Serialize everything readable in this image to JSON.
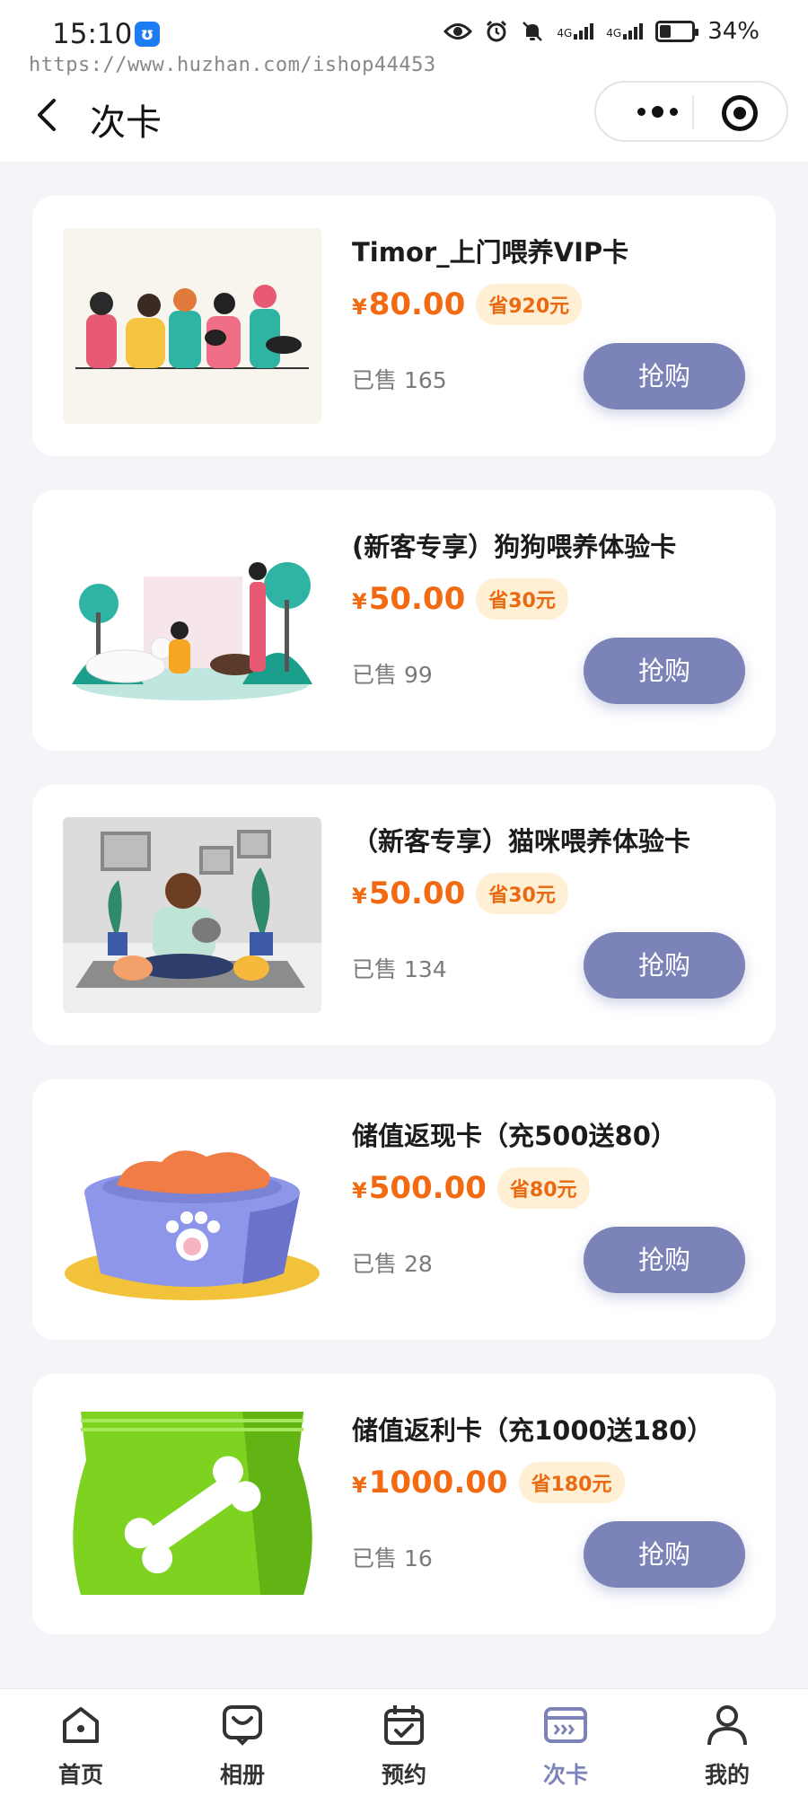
{
  "status_bar": {
    "time": "15:10",
    "battery": "34%",
    "battery_level": 0.34,
    "network_labels": [
      "4G",
      "4G"
    ]
  },
  "watermark": "https://www.huzhan.com/ishop44453",
  "header": {
    "title": "次卡"
  },
  "cards": [
    {
      "title": "Timor_上门喂养VIP卡",
      "currency": "¥",
      "price": "80.00",
      "save": "省920元",
      "sold": "已售 165",
      "button": "抢购",
      "image": "pet-lovers-group-illustration"
    },
    {
      "title": "(新客专享）狗狗喂养体验卡",
      "currency": "¥",
      "price": "50.00",
      "save": "省30元",
      "sold": "已售 99",
      "button": "抢购",
      "image": "dog-walking-park-illustration"
    },
    {
      "title": "（新客专享）猫咪喂养体验卡",
      "currency": "¥",
      "price": "50.00",
      "save": "省30元",
      "sold": "已售 134",
      "button": "抢购",
      "image": "girl-with-cats-illustration"
    },
    {
      "title": "储值返现卡（充500送80）",
      "currency": "¥",
      "price": "500.00",
      "save": "省80元",
      "sold": "已售 28",
      "button": "抢购",
      "image": "pet-food-bowl-illustration"
    },
    {
      "title": "储值返利卡（充1000送180）",
      "currency": "¥",
      "price": "1000.00",
      "save": "省180元",
      "sold": "已售 16",
      "button": "抢购",
      "image": "pet-food-bag-illustration"
    }
  ],
  "tabbar": {
    "active": 3,
    "items": [
      {
        "label": "首页",
        "icon": "home-icon"
      },
      {
        "label": "相册",
        "icon": "album-icon"
      },
      {
        "label": "预约",
        "icon": "calendar-icon"
      },
      {
        "label": "次卡",
        "icon": "card-icon"
      },
      {
        "label": "我的",
        "icon": "user-icon"
      }
    ]
  },
  "colors": {
    "accent": "#7c83b8",
    "price": "#f26b12",
    "save_bg": "#ffefd4",
    "page_bg": "#f4f5f9"
  }
}
